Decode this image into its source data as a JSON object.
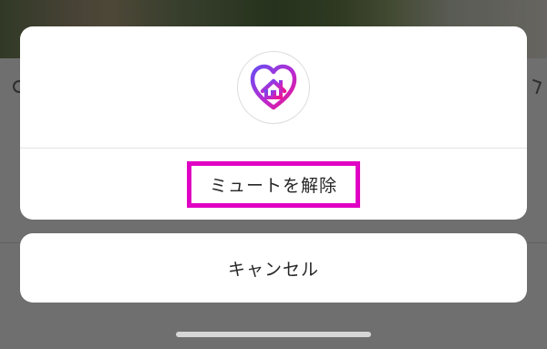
{
  "action_sheet": {
    "logo_icon": "heart-house-icon",
    "unmute_label": "ミュートを解除",
    "highlight_color": "#e000c4"
  },
  "cancel_sheet": {
    "cancel_label": "キャンセル"
  },
  "colors": {
    "backdrop": "#6f6f6f",
    "sheet": "#ffffff",
    "logo_gradient_start": "#6a4cf0",
    "logo_gradient_end": "#f0148c"
  }
}
